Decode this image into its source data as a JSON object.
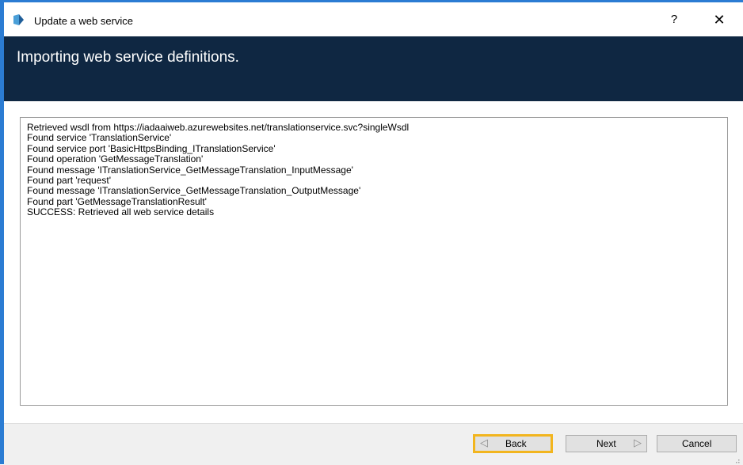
{
  "window": {
    "title": "Update a web service",
    "help_label": "?",
    "close_label": "✕"
  },
  "banner": {
    "heading": "Importing web service definitions."
  },
  "log": {
    "lines": [
      "Retrieved wsdl from https://iadaaiweb.azurewebsites.net/translationservice.svc?singleWsdl",
      "Found service 'TranslationService'",
      "Found service port 'BasicHttpsBinding_ITranslationService'",
      "Found operation 'GetMessageTranslation'",
      "Found message 'ITranslationService_GetMessageTranslation_InputMessage'",
      "Found part 'request'",
      "Found message 'ITranslationService_GetMessageTranslation_OutputMessage'",
      "Found part 'GetMessageTranslationResult'",
      "SUCCESS: Retrieved all web service details"
    ]
  },
  "footer": {
    "back_label": "Back",
    "back_chevron": "◁",
    "next_label": "Next",
    "next_chevron": "▷",
    "cancel_label": "Cancel"
  },
  "colors": {
    "banner_bg": "#0f2742",
    "window_border": "#2b7cd3",
    "focus_highlight": "#f2b51e"
  }
}
